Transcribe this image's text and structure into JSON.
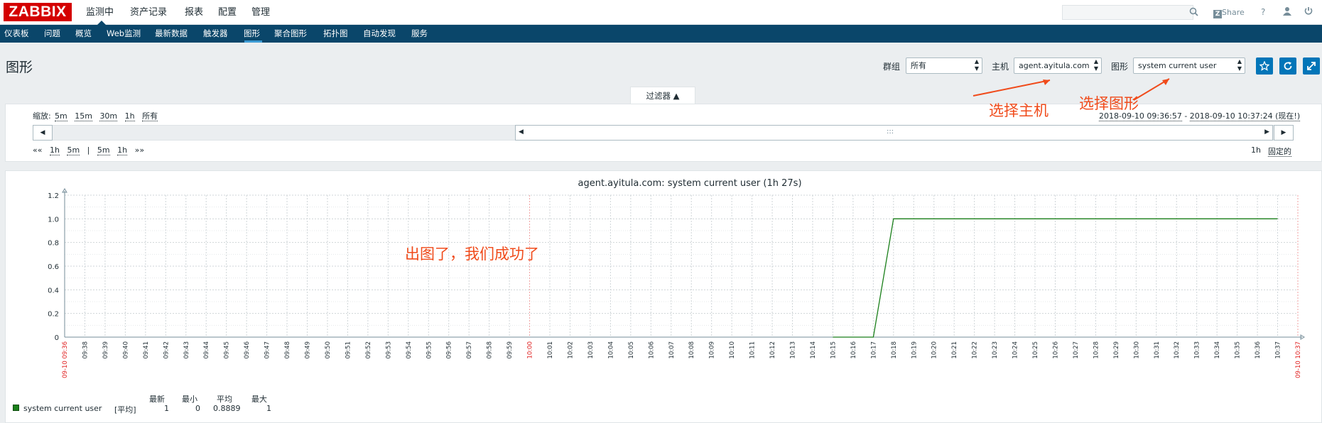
{
  "topbar": {
    "logo": "ZABBIX",
    "menu": [
      "监测中",
      "资产记录",
      "报表",
      "配置",
      "管理"
    ],
    "share_label": "Share",
    "help": "?",
    "search_placeholder": ""
  },
  "subnav": {
    "items": [
      "仪表板",
      "问题",
      "概览",
      "Web监测",
      "最新数据",
      "触发器",
      "图形",
      "聚合图形",
      "拓扑图",
      "自动发现",
      "服务"
    ],
    "active": "图形"
  },
  "header": {
    "title": "图形",
    "group_label": "群组",
    "group_value": "所有",
    "host_label": "主机",
    "host_value": "agent.ayitula.com",
    "graph_label": "图形",
    "graph_value": "system current user"
  },
  "filter": {
    "tab_label": "过滤器 ▲",
    "zoom_label": "缩放:",
    "zoom_options": [
      "5m",
      "15m",
      "30m",
      "1h",
      "所有"
    ],
    "nav_left": [
      "««",
      "1h",
      "5m",
      "|",
      "5m",
      "1h",
      "»»"
    ],
    "period_from": "2018-09-10 09:36:57",
    "period_sep": " - ",
    "period_to": "2018-09-10 10:37:24 (现在!)",
    "duration": "1h",
    "fixed_label": "固定的",
    "thumb_grip": ":::"
  },
  "annotations": {
    "select_host": "选择主机",
    "select_graph": "选择图形",
    "success": "出图了，我们成功了"
  },
  "chart_data": {
    "type": "line",
    "title": "agent.ayitula.com: system current user (1h 27s)",
    "ylim": [
      0,
      1.2
    ],
    "yticks": [
      "0",
      "0.2",
      "0.4",
      "0.6",
      "0.8",
      "1.0",
      "1.2"
    ],
    "xlabels": [
      "09-10 09:36",
      "09:38",
      "09:39",
      "09:40",
      "09:41",
      "09:42",
      "09:43",
      "09:44",
      "09:45",
      "09:46",
      "09:47",
      "09:48",
      "09:49",
      "09:50",
      "09:51",
      "09:52",
      "09:53",
      "09:54",
      "09:55",
      "09:56",
      "09:57",
      "09:58",
      "09:59",
      "10:00",
      "10:01",
      "10:02",
      "10:03",
      "10:04",
      "10:05",
      "10:06",
      "10:07",
      "10:08",
      "10:09",
      "10:10",
      "10:11",
      "10:12",
      "10:13",
      "10:14",
      "10:15",
      "10:16",
      "10:17",
      "10:18",
      "10:19",
      "10:20",
      "10:21",
      "10:22",
      "10:23",
      "10:24",
      "10:25",
      "10:26",
      "10:27",
      "10:28",
      "10:29",
      "10:30",
      "10:31",
      "10:32",
      "10:33",
      "10:34",
      "10:35",
      "10:36",
      "10:37",
      "09-10 10:37"
    ],
    "red_labels": [
      "09-10 09:36",
      "10:00",
      "09-10 10:37"
    ],
    "series": [
      {
        "name": "system current user",
        "color": "#1a7f1a",
        "points": [
          [
            "10:15",
            0
          ],
          [
            "10:16",
            0
          ],
          [
            "10:17",
            0
          ],
          [
            "10:18",
            1
          ],
          [
            "10:37",
            1
          ]
        ]
      }
    ],
    "grid": true
  },
  "legend": {
    "headers": [
      "最新",
      "最小",
      "平均",
      "最大"
    ],
    "name": "system current user",
    "func": "[平均]",
    "values": [
      "1",
      "0",
      "0.8889",
      "1"
    ],
    "color": "#1a7f1a"
  }
}
